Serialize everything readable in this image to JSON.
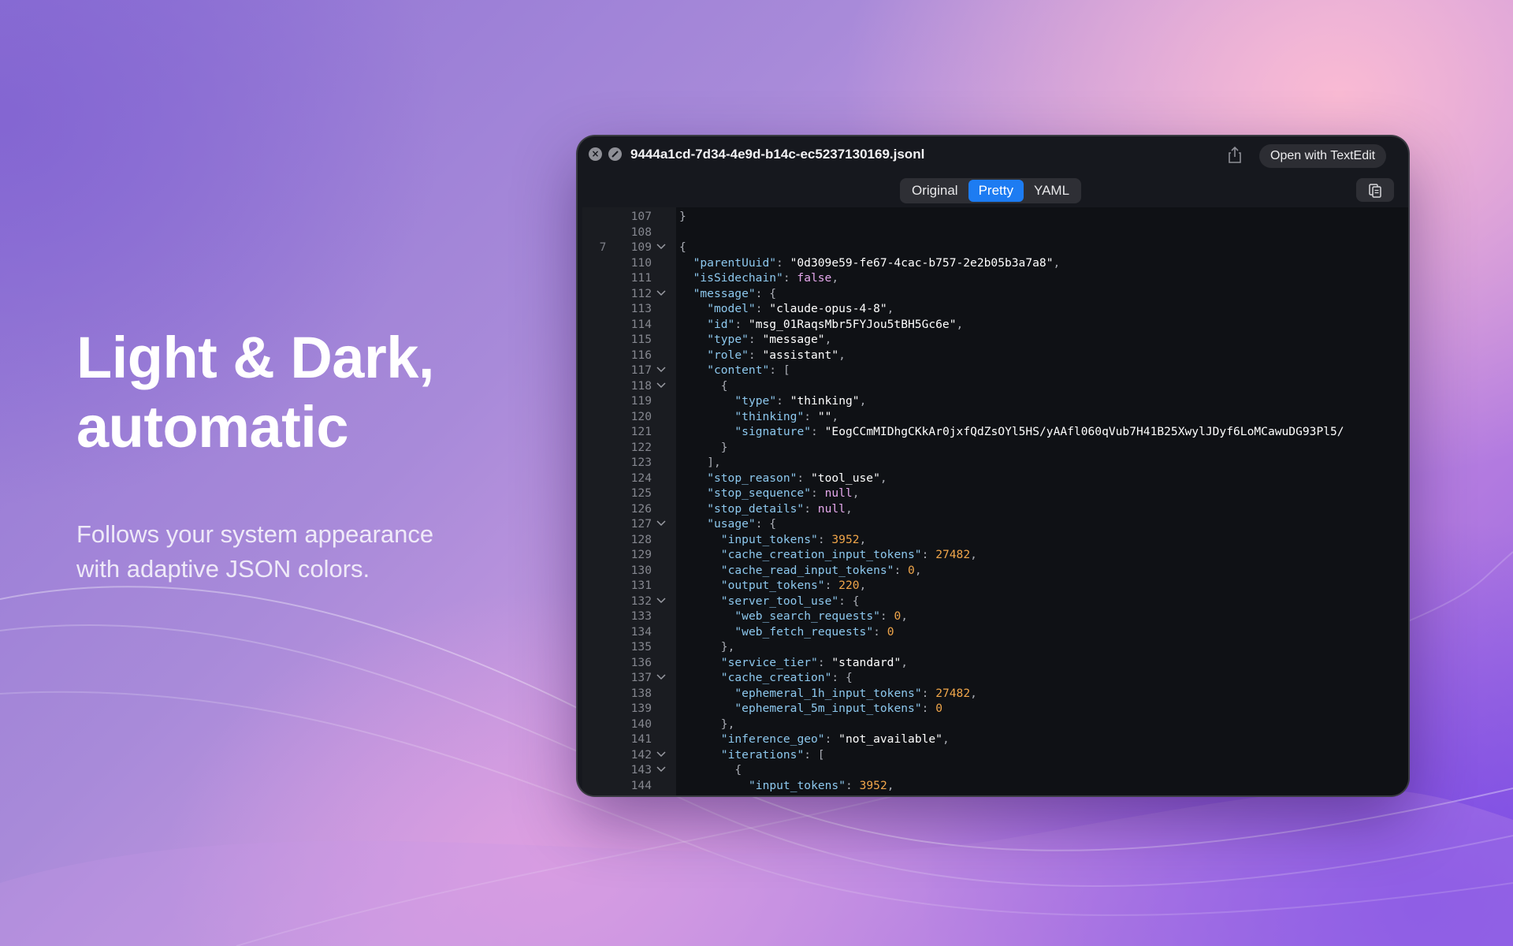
{
  "hero": {
    "title_line1": "Light & Dark,",
    "title_line2": "automatic",
    "subtitle_line1": "Follows your system appearance",
    "subtitle_line2": "with adaptive JSON colors."
  },
  "window": {
    "title": "9444a1cd-7d34-4e9d-b14c-ec5237130169.jsonl",
    "open_button": "Open with TextEdit",
    "close_icon": "close-icon",
    "minimize_icon": "minimize-icon",
    "share_icon": "share-icon",
    "copy_icon": "copy-icon"
  },
  "tabs": [
    {
      "label": "Original",
      "active": false
    },
    {
      "label": "Pretty",
      "active": true
    },
    {
      "label": "YAML",
      "active": false
    }
  ],
  "colors": {
    "accent": "#1d7cf2",
    "json_key": "#8dc8ee",
    "json_string": "#ffffff",
    "json_number": "#f0a64a",
    "json_literal": "#e5a8ec"
  },
  "lines": [
    {
      "num": "107",
      "indent": 0,
      "parts": [
        [
          "p",
          "}"
        ]
      ]
    },
    {
      "num": "108",
      "indent": 0,
      "parts": []
    },
    {
      "num": "109",
      "indent": 0,
      "fold": true,
      "marker": "7",
      "parts": [
        [
          "p",
          "{"
        ]
      ]
    },
    {
      "num": "110",
      "indent": 1,
      "parts": [
        [
          "k",
          "\"parentUuid\""
        ],
        [
          "p",
          ": "
        ],
        [
          "s",
          "\"0d309e59-fe67-4cac-b757-2e2b05b3a7a8\""
        ],
        [
          "p",
          ","
        ]
      ]
    },
    {
      "num": "111",
      "indent": 1,
      "parts": [
        [
          "k",
          "\"isSidechain\""
        ],
        [
          "p",
          ": "
        ],
        [
          "b",
          "false"
        ],
        [
          "p",
          ","
        ]
      ]
    },
    {
      "num": "112",
      "indent": 1,
      "fold": true,
      "parts": [
        [
          "k",
          "\"message\""
        ],
        [
          "p",
          ": {"
        ]
      ]
    },
    {
      "num": "113",
      "indent": 2,
      "parts": [
        [
          "k",
          "\"model\""
        ],
        [
          "p",
          ": "
        ],
        [
          "s",
          "\"claude-opus-4-8\""
        ],
        [
          "p",
          ","
        ]
      ]
    },
    {
      "num": "114",
      "indent": 2,
      "parts": [
        [
          "k",
          "\"id\""
        ],
        [
          "p",
          ": "
        ],
        [
          "s",
          "\"msg_01RaqsMbr5FYJou5tBH5Gc6e\""
        ],
        [
          "p",
          ","
        ]
      ]
    },
    {
      "num": "115",
      "indent": 2,
      "parts": [
        [
          "k",
          "\"type\""
        ],
        [
          "p",
          ": "
        ],
        [
          "s",
          "\"message\""
        ],
        [
          "p",
          ","
        ]
      ]
    },
    {
      "num": "116",
      "indent": 2,
      "parts": [
        [
          "k",
          "\"role\""
        ],
        [
          "p",
          ": "
        ],
        [
          "s",
          "\"assistant\""
        ],
        [
          "p",
          ","
        ]
      ]
    },
    {
      "num": "117",
      "indent": 2,
      "fold": true,
      "parts": [
        [
          "k",
          "\"content\""
        ],
        [
          "p",
          ": ["
        ]
      ]
    },
    {
      "num": "118",
      "indent": 3,
      "fold": true,
      "parts": [
        [
          "p",
          "{"
        ]
      ]
    },
    {
      "num": "119",
      "indent": 4,
      "parts": [
        [
          "k",
          "\"type\""
        ],
        [
          "p",
          ": "
        ],
        [
          "s",
          "\"thinking\""
        ],
        [
          "p",
          ","
        ]
      ]
    },
    {
      "num": "120",
      "indent": 4,
      "parts": [
        [
          "k",
          "\"thinking\""
        ],
        [
          "p",
          ": "
        ],
        [
          "s",
          "\"\""
        ],
        [
          "p",
          ","
        ]
      ]
    },
    {
      "num": "121",
      "indent": 4,
      "parts": [
        [
          "k",
          "\"signature\""
        ],
        [
          "p",
          ": "
        ],
        [
          "s",
          "\"EogCCmMIDhgCKkAr0jxfQdZsOYl5HS/yAAfl060qVub7H41B25XwylJDyf6LoMCawuDG93Pl5/"
        ]
      ]
    },
    {
      "num": "122",
      "indent": 3,
      "parts": [
        [
          "p",
          "}"
        ]
      ]
    },
    {
      "num": "123",
      "indent": 2,
      "parts": [
        [
          "p",
          "],"
        ]
      ]
    },
    {
      "num": "124",
      "indent": 2,
      "parts": [
        [
          "k",
          "\"stop_reason\""
        ],
        [
          "p",
          ": "
        ],
        [
          "s",
          "\"tool_use\""
        ],
        [
          "p",
          ","
        ]
      ]
    },
    {
      "num": "125",
      "indent": 2,
      "parts": [
        [
          "k",
          "\"stop_sequence\""
        ],
        [
          "p",
          ": "
        ],
        [
          "b",
          "null"
        ],
        [
          "p",
          ","
        ]
      ]
    },
    {
      "num": "126",
      "indent": 2,
      "parts": [
        [
          "k",
          "\"stop_details\""
        ],
        [
          "p",
          ": "
        ],
        [
          "b",
          "null"
        ],
        [
          "p",
          ","
        ]
      ]
    },
    {
      "num": "127",
      "indent": 2,
      "fold": true,
      "parts": [
        [
          "k",
          "\"usage\""
        ],
        [
          "p",
          ": {"
        ]
      ]
    },
    {
      "num": "128",
      "indent": 3,
      "parts": [
        [
          "k",
          "\"input_tokens\""
        ],
        [
          "p",
          ": "
        ],
        [
          "n",
          "3952"
        ],
        [
          "p",
          ","
        ]
      ]
    },
    {
      "num": "129",
      "indent": 3,
      "parts": [
        [
          "k",
          "\"cache_creation_input_tokens\""
        ],
        [
          "p",
          ": "
        ],
        [
          "n",
          "27482"
        ],
        [
          "p",
          ","
        ]
      ]
    },
    {
      "num": "130",
      "indent": 3,
      "parts": [
        [
          "k",
          "\"cache_read_input_tokens\""
        ],
        [
          "p",
          ": "
        ],
        [
          "n",
          "0"
        ],
        [
          "p",
          ","
        ]
      ]
    },
    {
      "num": "131",
      "indent": 3,
      "parts": [
        [
          "k",
          "\"output_tokens\""
        ],
        [
          "p",
          ": "
        ],
        [
          "n",
          "220"
        ],
        [
          "p",
          ","
        ]
      ]
    },
    {
      "num": "132",
      "indent": 3,
      "fold": true,
      "parts": [
        [
          "k",
          "\"server_tool_use\""
        ],
        [
          "p",
          ": {"
        ]
      ]
    },
    {
      "num": "133",
      "indent": 4,
      "parts": [
        [
          "k",
          "\"web_search_requests\""
        ],
        [
          "p",
          ": "
        ],
        [
          "n",
          "0"
        ],
        [
          "p",
          ","
        ]
      ]
    },
    {
      "num": "134",
      "indent": 4,
      "parts": [
        [
          "k",
          "\"web_fetch_requests\""
        ],
        [
          "p",
          ": "
        ],
        [
          "n",
          "0"
        ]
      ]
    },
    {
      "num": "135",
      "indent": 3,
      "parts": [
        [
          "p",
          "},"
        ]
      ]
    },
    {
      "num": "136",
      "indent": 3,
      "parts": [
        [
          "k",
          "\"service_tier\""
        ],
        [
          "p",
          ": "
        ],
        [
          "s",
          "\"standard\""
        ],
        [
          "p",
          ","
        ]
      ]
    },
    {
      "num": "137",
      "indent": 3,
      "fold": true,
      "parts": [
        [
          "k",
          "\"cache_creation\""
        ],
        [
          "p",
          ": {"
        ]
      ]
    },
    {
      "num": "138",
      "indent": 4,
      "parts": [
        [
          "k",
          "\"ephemeral_1h_input_tokens\""
        ],
        [
          "p",
          ": "
        ],
        [
          "n",
          "27482"
        ],
        [
          "p",
          ","
        ]
      ]
    },
    {
      "num": "139",
      "indent": 4,
      "parts": [
        [
          "k",
          "\"ephemeral_5m_input_tokens\""
        ],
        [
          "p",
          ": "
        ],
        [
          "n",
          "0"
        ]
      ]
    },
    {
      "num": "140",
      "indent": 3,
      "parts": [
        [
          "p",
          "},"
        ]
      ]
    },
    {
      "num": "141",
      "indent": 3,
      "parts": [
        [
          "k",
          "\"inference_geo\""
        ],
        [
          "p",
          ": "
        ],
        [
          "s",
          "\"not_available\""
        ],
        [
          "p",
          ","
        ]
      ]
    },
    {
      "num": "142",
      "indent": 3,
      "fold": true,
      "parts": [
        [
          "k",
          "\"iterations\""
        ],
        [
          "p",
          ": ["
        ]
      ]
    },
    {
      "num": "143",
      "indent": 4,
      "fold": true,
      "parts": [
        [
          "p",
          "{"
        ]
      ]
    },
    {
      "num": "144",
      "indent": 5,
      "parts": [
        [
          "k",
          "\"input_tokens\""
        ],
        [
          "p",
          ": "
        ],
        [
          "n",
          "3952"
        ],
        [
          "p",
          ","
        ]
      ]
    }
  ]
}
